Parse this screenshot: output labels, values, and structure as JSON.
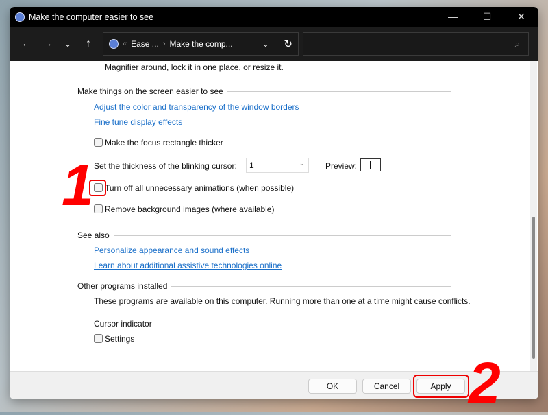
{
  "window": {
    "title": "Make the computer easier to see",
    "minimize": "—",
    "maximize": "☐",
    "close": "✕"
  },
  "toolbar": {
    "back": "←",
    "forward": "→",
    "recent": "⌄",
    "up": "↑",
    "breadcrumb": [
      "Ease ...",
      "Make the comp..."
    ],
    "breadcrumb_overflow": "«",
    "breadcrumb_sep": "›",
    "dropdown": "⌄",
    "refresh": "↻",
    "search_placeholder": "",
    "search_icon": "⌕"
  },
  "content": {
    "magnifier_text": "Magnifier around, lock it in one place, or resize it.",
    "screen_section": "Make things on the screen easier to see",
    "link_borders": "Adjust the color and transparency of the window borders",
    "link_display": "Fine tune display effects",
    "focus_rect": {
      "label": "Make the focus rectangle thicker",
      "checked": false
    },
    "cursor_label": "Set the thickness of the blinking cursor:",
    "cursor_value": "1",
    "preview_label": "Preview:",
    "animations": {
      "label": "Turn off all unnecessary animations (when possible)",
      "checked": false
    },
    "bg_images": {
      "label": "Remove background images (where available)",
      "checked": false
    },
    "see_also": "See also",
    "link_personalize": "Personalize appearance and sound effects",
    "link_assistive": "Learn about additional assistive technologies online",
    "other_programs": "Other programs installed",
    "programs_text": "These programs are available on this computer. Running more than one at a time might cause conflicts.",
    "cursor_indicator": "Cursor indicator",
    "settings": {
      "label": "Settings",
      "checked": false
    }
  },
  "footer": {
    "ok": "OK",
    "cancel": "Cancel",
    "apply": "Apply"
  },
  "annotations": {
    "step1": "1",
    "step2": "2",
    "color": "#ff0000"
  },
  "colors": {
    "link": "#1a6fc9",
    "titlebar": "#000000",
    "toolbar": "#1c1c1c"
  }
}
